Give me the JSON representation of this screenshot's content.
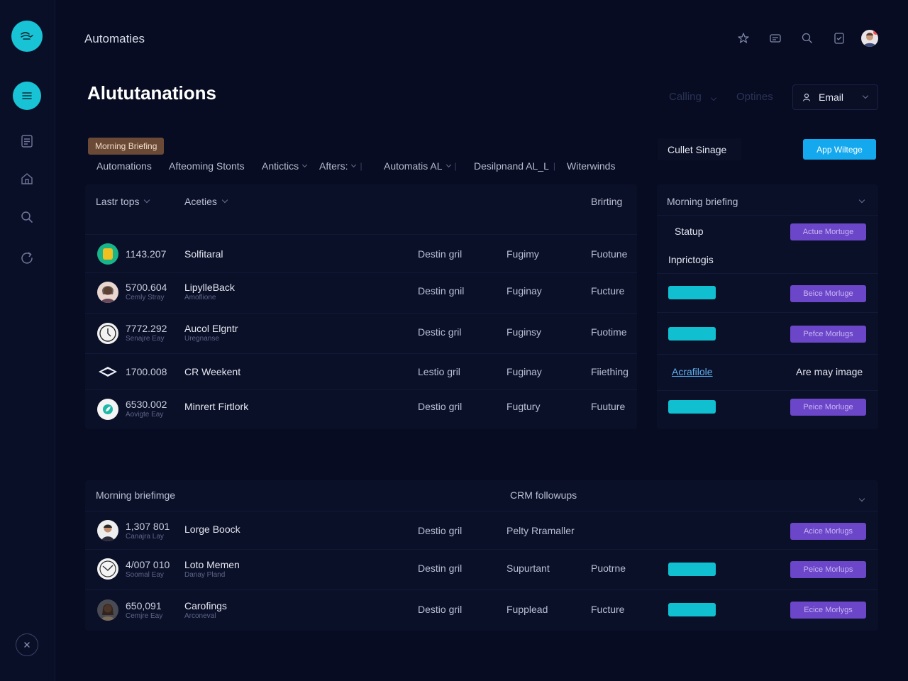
{
  "app": {
    "title": "Automaties"
  },
  "page": {
    "title": "Alututanations"
  },
  "header": {
    "filters": {
      "calling": "Calling",
      "options": "Optines"
    },
    "email_select": "Email",
    "icons": [
      "star-icon",
      "message-icon",
      "search-icon",
      "document-icon",
      "user-avatar"
    ]
  },
  "sidebar": {
    "items": [
      "menu-icon",
      "list-icon",
      "home-icon",
      "search-icon",
      "refresh-icon"
    ]
  },
  "chip": "Morning Briefing",
  "tabs": [
    "Automations",
    "Afteoming Stonts",
    "Antictics",
    "Afters:",
    "Automatis AL",
    "Desilpnand AL_L",
    "Witerwinds"
  ],
  "main_table": {
    "headers": {
      "col1": "Lastr tops",
      "col2": "Aceties",
      "col3": "Brirting"
    },
    "rows": [
      {
        "id": "1143.207",
        "sub": "",
        "name": "Solfitaral",
        "name_sub": "",
        "c1": "Destin gril",
        "c2": "Fugimy",
        "c3": "Fuotune"
      },
      {
        "id": "5700.604",
        "sub": "Cemly Stray",
        "name": "LipylleBack",
        "name_sub": "Amoflione",
        "c1": "Destin gnil",
        "c2": "Fuginay",
        "c3": "Fucture"
      },
      {
        "id": "7772.292",
        "sub": "Senajre Eay",
        "name": "Aucol Elgntr",
        "name_sub": "Uregnanse",
        "c1": "Destic gril",
        "c2": "Fuginsy",
        "c3": "Fuotime"
      },
      {
        "id": "1700.008",
        "sub": "",
        "name": "CR Weekent",
        "name_sub": "",
        "c1": "Lestio gril",
        "c2": "Fuginay",
        "c3": "Fiiething"
      },
      {
        "id": "6530.002",
        "sub": "Aovigte Eay",
        "name": "Minrert Firtlork",
        "name_sub": "",
        "c1": "Destio gril",
        "c2": "Fugtury",
        "c3": "Fuuture"
      }
    ]
  },
  "side_panel": {
    "button_outline": "Cullet Sinage",
    "button_blue": "App Wiltege",
    "header": "Morning briefing",
    "status_label": "Statup",
    "status_btn": "Actue Mortuge",
    "section_label": "Inprictogis",
    "rows": [
      {
        "btn": "Beice Morluge"
      },
      {
        "btn": "Pefce Morlugs"
      },
      {
        "link": "Acrafilole",
        "text": "Are may image"
      },
      {
        "btn": "Peice Morluge"
      }
    ]
  },
  "bottom_table": {
    "headers": {
      "left": "Morning briefimge",
      "right": "CRM followups"
    },
    "rows": [
      {
        "id": "1,307 801",
        "sub": "Canajra Lay",
        "name": "Lorge Boock",
        "name_sub": "",
        "c1": "Destio gril",
        "c2": "Pelty Rramaller",
        "c3": "",
        "btn": "Acice Morlugs"
      },
      {
        "id": "4/007 010",
        "sub": "Soomal Eay",
        "name": "Loto Memen",
        "name_sub": "Danay Pland",
        "c1": "Destin gril",
        "c2": "Supurtant",
        "c3": "Puotrne",
        "btn": "Peice Morlups"
      },
      {
        "id": "650,091",
        "sub": "Cemjre Eay",
        "name": "Carofings",
        "name_sub": "Arconeval",
        "c1": "Destio gril",
        "c2": "Fupplead",
        "c3": "Fucture",
        "btn": "Ecice Morlygs"
      }
    ]
  },
  "colors": {
    "accent": "#19c3d6",
    "purple": "#6b46c8",
    "blue": "#14a9ee",
    "bg": "#080c22"
  }
}
